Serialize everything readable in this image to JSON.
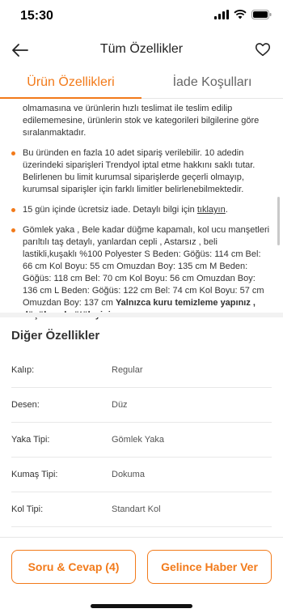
{
  "status_bar": {
    "time": "15:30"
  },
  "nav": {
    "title": "Tüm Özellikler"
  },
  "tabs": [
    {
      "label": "Ürün Özellikleri",
      "active": true
    },
    {
      "label": "İade Koşulları",
      "active": false
    }
  ],
  "description": {
    "partial_text": "olmamasına ve ürünlerin hızlı teslimat ile teslim edilip edilememesine, ürünlerin stok ve kategorileri bilgilerine göre sıralanmaktadır.",
    "item_limit": "Bu üründen en fazla 10 adet sipariş verilebilir. 10 adedin üzerindeki siparişleri Trendyol iptal etme hakkını saklı tutar. Belirlenen bu limit kurumsal siparişlerde geçerli olmayıp, kurumsal siparişler için farklı limitler belirlenebilmektedir.",
    "item_return_text": "15 gün içinde ücretsiz iade. Detaylı bilgi için ",
    "item_return_link": "tıklayın",
    "item_return_end": ".",
    "item_details_text": "Gömlek yaka , Bele kadar düğme kapamalı, kol ucu manşetleri parıltılı taş detaylı, yanlardan cepli , Astarsız , beli lastikli,kuşaklı %100 Polyester S Beden: Göğüs: 114 cm Bel: 66 cm Kol Boyu: 55 cm Omuzdan Boy: 135 cm M Beden: Göğüs: 118 cm Bel: 70 cm Kol Boyu: 56 cm Omuzdan Boy: 136 cm L Beden: Göğüs: 122 cm Bel: 74 cm Kol Boyu: 57 cm Omuzdan Boy: 137 cm ",
    "item_details_bold": "Yalnızca kuru temizleme yapınız , düşük ısıda ütüleyiniz"
  },
  "other_features": {
    "title": "Diğer Özellikler",
    "rows": [
      {
        "key": "Kalıp:",
        "value": "Regular"
      },
      {
        "key": "Desen:",
        "value": "Düz"
      },
      {
        "key": "Yaka Tipi:",
        "value": "Gömlek Yaka"
      },
      {
        "key": "Kumaş Tipi:",
        "value": "Dokuma"
      },
      {
        "key": "Kol Tipi:",
        "value": "Standart Kol"
      }
    ]
  },
  "bottom_bar": {
    "qa_button": "Soru & Cevap (4)",
    "notify_button": "Gelince Haber Ver"
  },
  "colors": {
    "accent": "#f27a1a",
    "text": "#333333"
  }
}
